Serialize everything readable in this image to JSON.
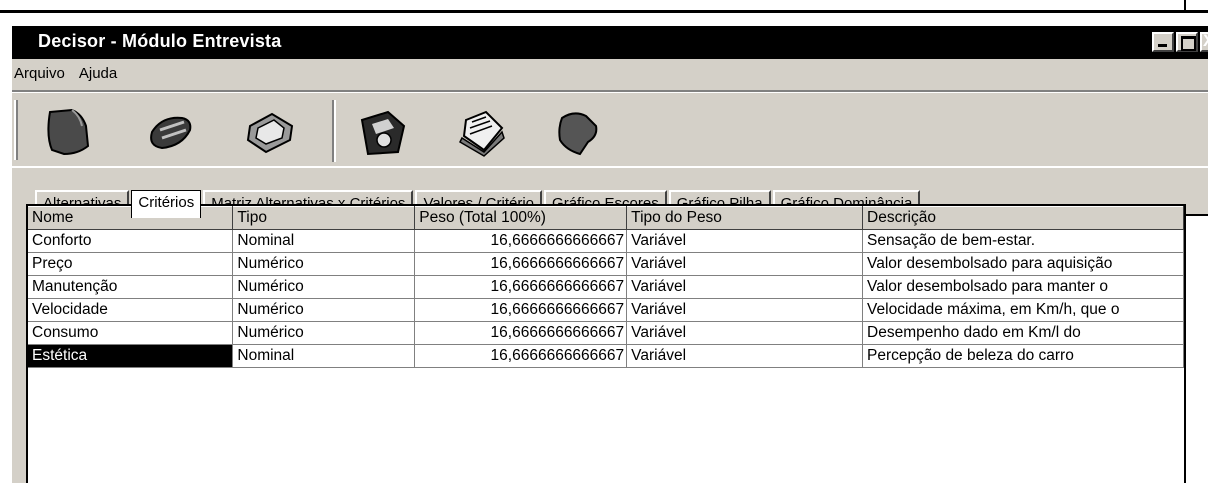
{
  "window": {
    "title": "Decisor - Módulo Entrevista",
    "close_glyph": "X"
  },
  "menu": [
    {
      "label": "Arquivo"
    },
    {
      "label": "Ajuda"
    }
  ],
  "toolbar": {
    "buttons": [
      {
        "icon": "page-icon"
      },
      {
        "icon": "pencil-icon"
      },
      {
        "icon": "eraser-icon"
      },
      {
        "icon": "save-disk-icon"
      },
      {
        "icon": "notepad-icon"
      },
      {
        "icon": "brush-icon"
      }
    ]
  },
  "tabs": [
    {
      "label": "Alternativas",
      "active": false
    },
    {
      "label": "Critérios",
      "active": true
    },
    {
      "label": "Matriz Alternativas x Critérios",
      "active": false
    },
    {
      "label": "Valores / Critério",
      "active": false
    },
    {
      "label": "Gráfico Escores",
      "active": false
    },
    {
      "label": "Gráfico Pilha",
      "active": false
    },
    {
      "label": "Gráfico Dominância",
      "active": false
    }
  ],
  "table": {
    "columns": [
      "Nome",
      "Tipo",
      "Peso (Total 100%)",
      "Tipo do Peso",
      "Descrição"
    ],
    "rows": [
      [
        "Conforto",
        "Nominal",
        "16,6666666666667",
        "Variável",
        "Sensação de bem-estar."
      ],
      [
        "Preço",
        "Numérico",
        "16,6666666666667",
        "Variável",
        "Valor desembolsado para aquisição"
      ],
      [
        "Manutenção",
        "Numérico",
        "16,6666666666667",
        "Variável",
        "Valor desembolsado para manter o"
      ],
      [
        "Velocidade",
        "Numérico",
        "16,6666666666667",
        "Variável",
        "Velocidade máxima, em Km/h, que o"
      ],
      [
        "Consumo",
        "Numérico",
        "16,6666666666667",
        "Variável",
        "Desempenho dado em Km/l do"
      ],
      [
        "Estética",
        "Nominal",
        "16,6666666666667",
        "Variável",
        "Percepção de beleza do carro"
      ]
    ],
    "selected": {
      "row": 5,
      "col": 0
    }
  }
}
